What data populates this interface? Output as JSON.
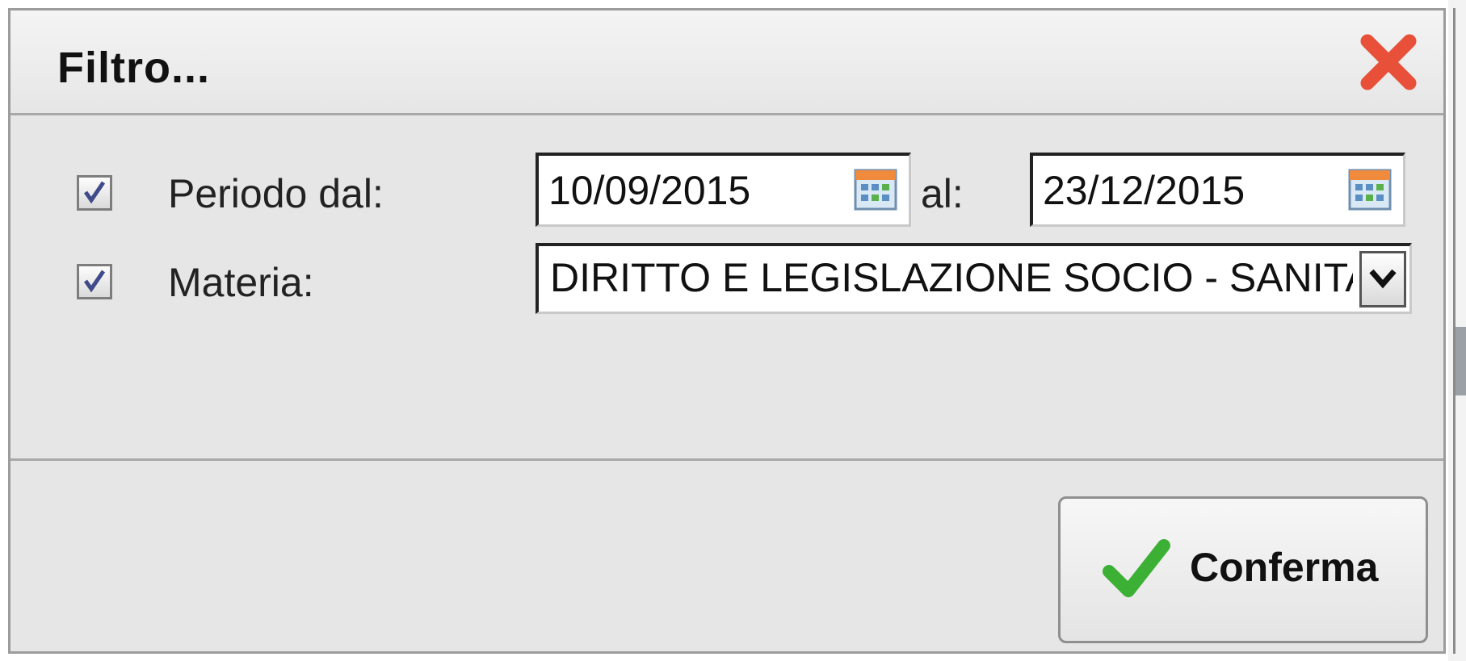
{
  "dialog": {
    "title": "Filtro...",
    "close_icon": "close-icon"
  },
  "filters": {
    "period": {
      "checked": true,
      "label": "Periodo dal:",
      "from_value": "10/09/2015",
      "to_label": "al:",
      "to_value": "23/12/2015",
      "calendar_icon": "calendar-icon"
    },
    "subject": {
      "checked": true,
      "label": "Materia:",
      "selected_value": "DIRITTO E LEGISLAZIONE SOCIO - SANITARIA",
      "dropdown_icon": "chevron-down-icon"
    }
  },
  "footer": {
    "confirm_label": "Conferma",
    "confirm_icon": "checkmark-icon"
  },
  "colors": {
    "close_red": "#e8503a",
    "check_green": "#3cb034",
    "dialog_bg": "#e6e6e6"
  }
}
